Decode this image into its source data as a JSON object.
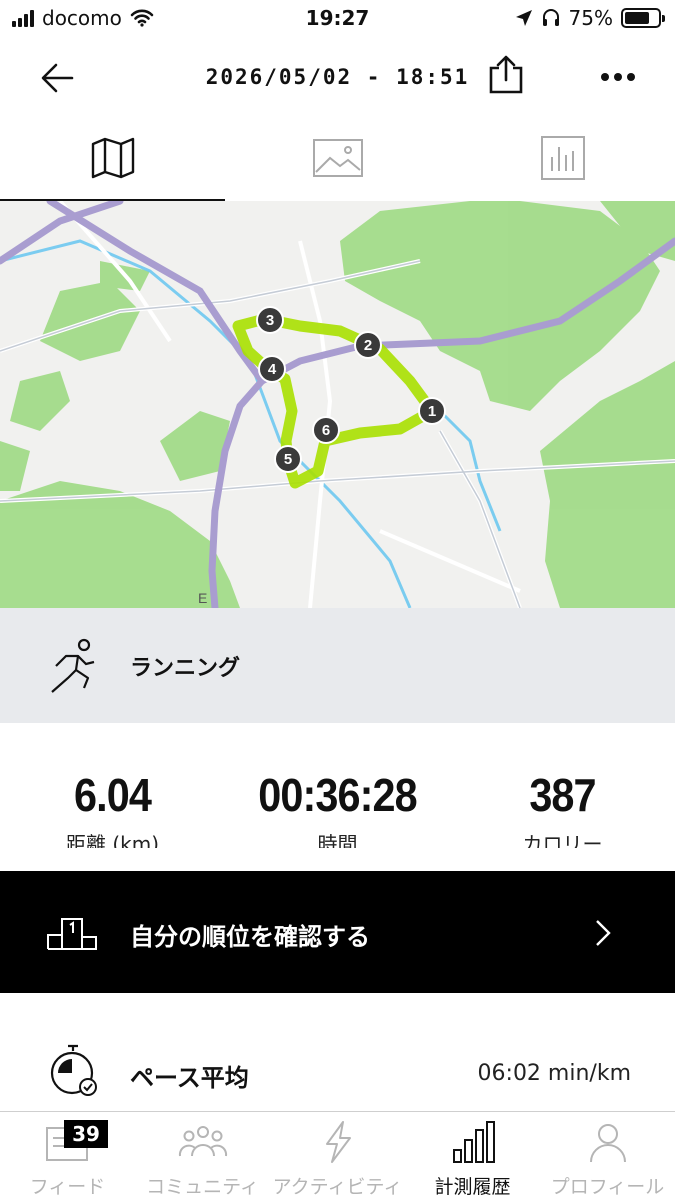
{
  "status_bar": {
    "carrier": "docomo",
    "time": "19:27",
    "battery": "75%",
    "battery_level": 0.75
  },
  "header": {
    "title": "2026/05/02 - 18:51"
  },
  "tabs": [
    {
      "name": "map-tab",
      "icon": "map-icon",
      "active": true
    },
    {
      "name": "photo-tab",
      "icon": "image-icon",
      "active": false
    },
    {
      "name": "chart-tab",
      "icon": "bar-chart-icon",
      "active": false
    }
  ],
  "map": {
    "markers": [
      "1",
      "2",
      "3",
      "4",
      "5",
      "6"
    ],
    "road_label": "E",
    "route_color": "#a8e000"
  },
  "activity": {
    "type": "ランニング"
  },
  "stats": {
    "distance": {
      "value": "6.04",
      "label": "距離 (km)"
    },
    "time": {
      "value": "00:36:28",
      "label": "時間"
    },
    "calories": {
      "value": "387",
      "label": "カロリー"
    }
  },
  "ranking": {
    "label": "自分の順位を確認する"
  },
  "pace": {
    "label": "ペース平均",
    "value": "06:02 min/km"
  },
  "bottom_nav": {
    "items": [
      {
        "label": "フィード",
        "icon": "feed-icon",
        "badge": "39"
      },
      {
        "label": "コミュニティ",
        "icon": "community-icon"
      },
      {
        "label": "アクティビティ",
        "icon": "lightning-icon"
      },
      {
        "label": "計測履歴",
        "icon": "history-bars-icon",
        "active": true
      },
      {
        "label": "プロフィール",
        "icon": "profile-icon"
      }
    ]
  }
}
